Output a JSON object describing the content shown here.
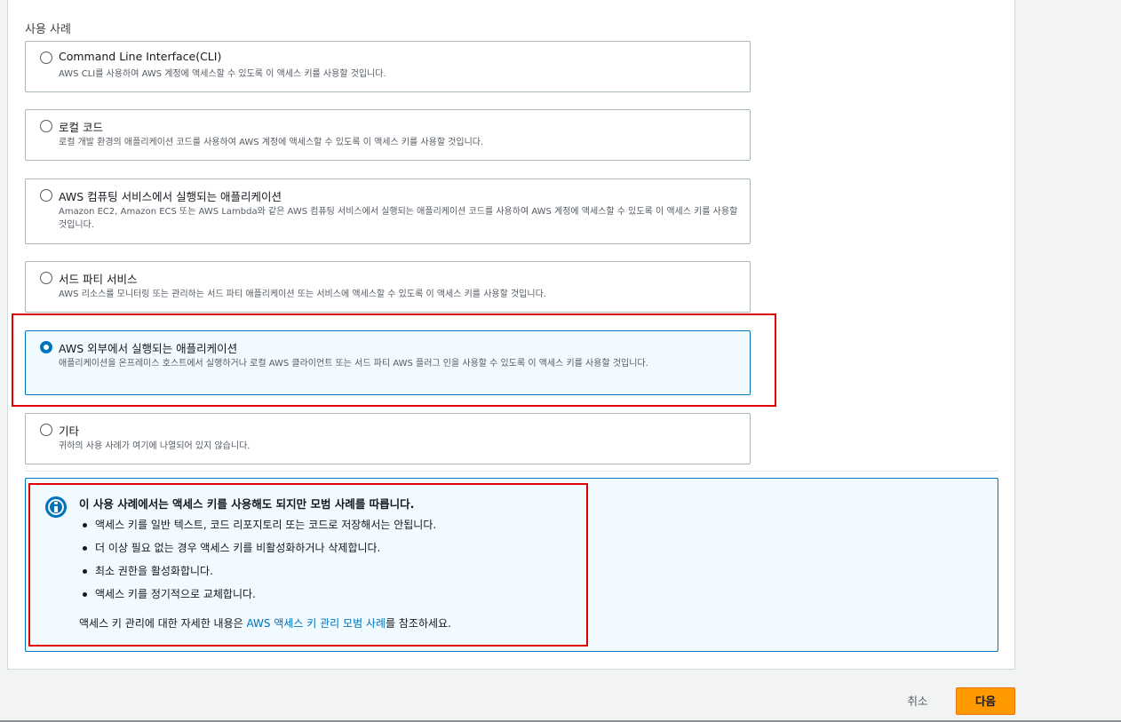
{
  "section": {
    "label": "사용 사례"
  },
  "options": [
    {
      "title": "Command Line Interface(CLI)",
      "desc": "AWS CLI를 사용하여 AWS 계정에 액세스할 수 있도록 이 액세스 키를 사용할 것입니다.",
      "selected": false
    },
    {
      "title": "로컬 코드",
      "desc": "로컬 개발 환경의 애플리케이션 코드를 사용하여 AWS 계정에 액세스할 수 있도록 이 액세스 키를 사용할 것입니다.",
      "selected": false
    },
    {
      "title": "AWS 컴퓨팅 서비스에서 실행되는 애플리케이션",
      "desc": "Amazon EC2, Amazon ECS 또는 AWS Lambda와 같은 AWS 컴퓨팅 서비스에서 실행되는 애플리케이션 코드를 사용하여 AWS 계정에 액세스할 수 있도록 이 액세스 키를 사용할 것입니다.",
      "selected": false
    },
    {
      "title": "서드 파티 서비스",
      "desc": "AWS 리소스를 모니터링 또는 관리하는 서드 파티 애플리케이션 또는 서비스에 액세스할 수 있도록 이 액세스 키를 사용할 것입니다.",
      "selected": false
    },
    {
      "title": "AWS 외부에서 실행되는 애플리케이션",
      "desc": "애플리케이션을 온프레미스 호스트에서 실행하거나 로컬 AWS 클라이언트 또는 서드 파티 AWS 플러그 인을 사용할 수 있도록 이 액세스 키를 사용할 것입니다.",
      "selected": true
    },
    {
      "title": "기타",
      "desc": "귀하의 사용 사례가 여기에 나열되어 있지 않습니다.",
      "selected": false
    }
  ],
  "info": {
    "title": "이 사용 사례에서는 액세스 키를 사용해도 되지만 모범 사례를 따릅니다.",
    "items": [
      "액세스 키를 일반 텍스트, 코드 리포지토리 또는 코드로 저장해서는 안됩니다.",
      "더 이상 필요 없는 경우 액세스 키를 비활성화하거나 삭제합니다.",
      "최소 권한을 활성화합니다.",
      "액세스 키를 정기적으로 교체합니다."
    ],
    "footer_prefix": "액세스 키 관리에 대한 자세한 내용은 ",
    "footer_link": "AWS 액세스 키 관리 모범 사례",
    "footer_suffix": "를 참조하세요."
  },
  "buttons": {
    "cancel": "취소",
    "next": "다음"
  },
  "colors": {
    "accent": "#0073bb",
    "primary_button": "#ff9900",
    "highlight": "#e00000"
  }
}
